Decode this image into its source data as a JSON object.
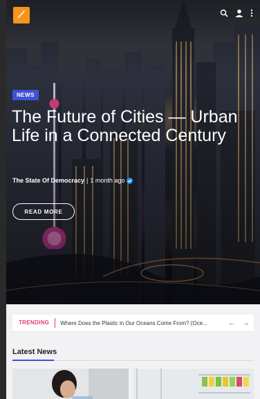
{
  "header": {
    "logo_icon": "pen-nib-icon",
    "search_icon": "search-icon",
    "user_icon": "user-icon",
    "menu_icon": "more-vertical-icon"
  },
  "hero": {
    "category": "NEWS",
    "title": "The Future of Cities — Urban Life in a Connected Century",
    "author": "The State Of Democracy",
    "separator": "|",
    "time": "1 month ago",
    "read_more": "READ MORE"
  },
  "trending": {
    "label": "TRENDING",
    "headline": "Where Does the Plastic in Our Oceans Come From? (Oce...",
    "prev": "←",
    "next": "→"
  },
  "latest": {
    "title": "Latest News"
  },
  "colors": {
    "accent": "#3f51d4",
    "trending": "#e6397a",
    "logo": "#f7941d"
  }
}
